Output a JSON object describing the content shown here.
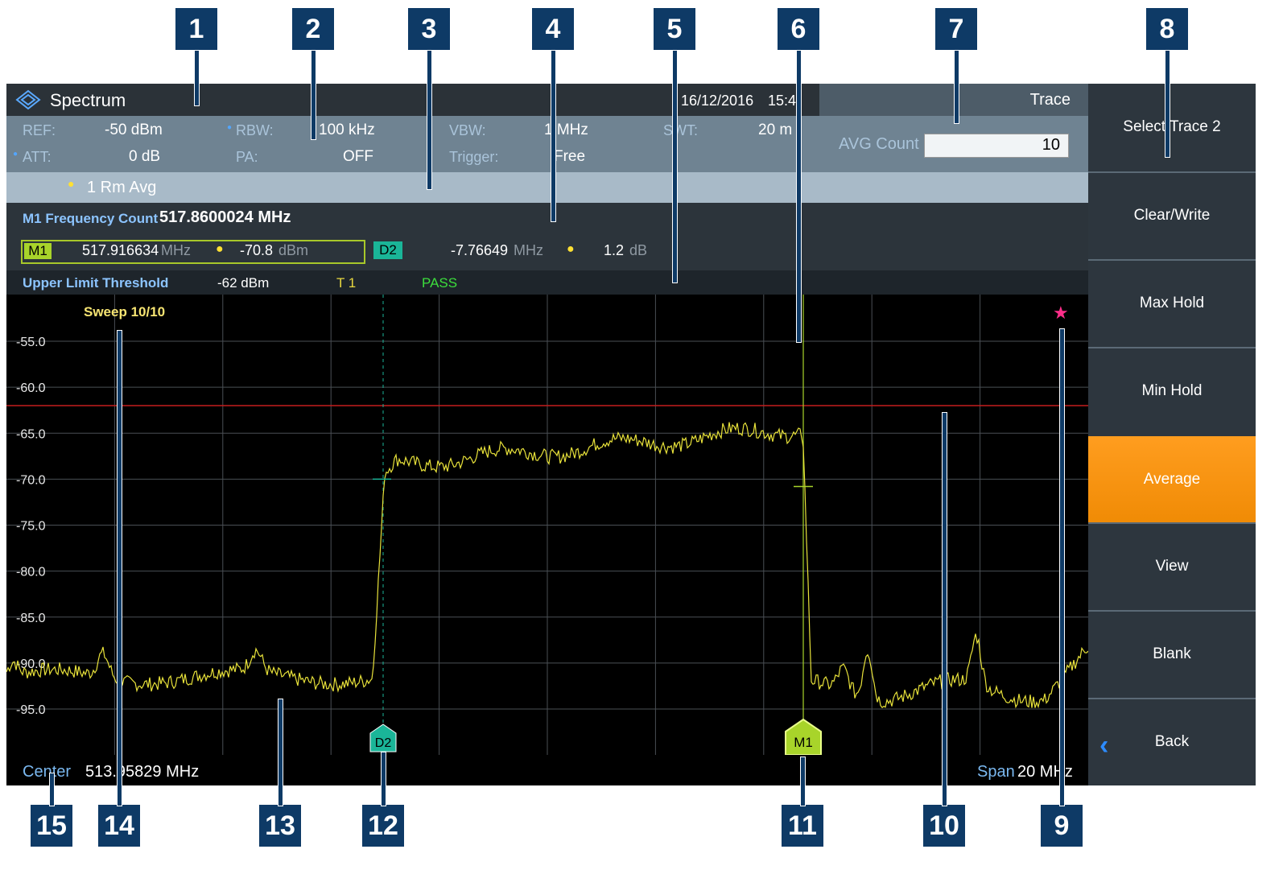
{
  "callouts": [
    "1",
    "2",
    "3",
    "4",
    "5",
    "6",
    "7",
    "8",
    "9",
    "10",
    "11",
    "12",
    "13",
    "14",
    "15"
  ],
  "app": {
    "title": "Spectrum",
    "date": "16/12/2016",
    "time": "15:4"
  },
  "trace_panel": {
    "title": "Trace",
    "avg_count_label": "AVG Count",
    "avg_count_value": "10"
  },
  "params": {
    "ref_label": "REF:",
    "ref_value": "-50 dBm",
    "att_label": "ATT:",
    "att_value": "0 dB",
    "rbw_label": "RBW:",
    "rbw_value": "100 kHz",
    "pa_label": "PA:",
    "pa_value": "OFF",
    "vbw_label": "VBW:",
    "vbw_value": "1 MHz",
    "trigger_label": "Trigger:",
    "trigger_value": "Free",
    "swt_label": "SWT:",
    "swt_value": "20 m"
  },
  "trace_info": {
    "text": "1 Rm  Avg"
  },
  "freq_count": {
    "label": "M1 Frequency Count",
    "value": "517.8600024 MHz"
  },
  "markers": {
    "m1": {
      "tag": "M1",
      "freq": "517.916634",
      "freq_unit": "MHz",
      "level": "-70.8",
      "level_unit": "dBm"
    },
    "d2": {
      "tag": "D2",
      "freq": "-7.76649",
      "freq_unit": "MHz",
      "level": "1.2",
      "level_unit": "dB"
    }
  },
  "limit": {
    "label": "Upper Limit Threshold",
    "value": "-62 dBm",
    "trace": "T 1",
    "result": "PASS"
  },
  "plot": {
    "sweep": "Sweep 10/10",
    "y_ticks": [
      "-55.0",
      "-60.0",
      "-65.0",
      "-70.0",
      "-75.0",
      "-80.0",
      "-85.0",
      "-90.0",
      "-95.0"
    ],
    "y_range": [
      -100,
      -52
    ],
    "limit_line_dbm": -62,
    "marker_d2_tag": "D2",
    "marker_m1_tag": "M1"
  },
  "status": {
    "center_label": "Center",
    "center_value": "513.95829 MHz",
    "span_label": "Span",
    "span_value": "20 MHz"
  },
  "softkeys": [
    "Select Trace 2",
    "Clear/Write",
    "Max Hold",
    "Min Hold",
    "Average",
    "View",
    "Blank",
    "Back"
  ],
  "colors": {
    "trace": "#e8e23a",
    "limit": "#c41e1e",
    "active_softkey": "#f7920f",
    "d2": "#1ab598",
    "m1": "#a8d42a"
  }
}
